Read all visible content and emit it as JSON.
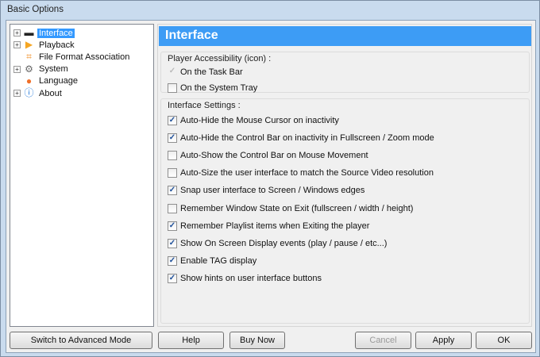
{
  "window": {
    "title": "Basic Options"
  },
  "tree": [
    {
      "label": "Interface",
      "icon": "monitor-icon",
      "expandable": true,
      "selected": true
    },
    {
      "label": "Playback",
      "icon": "play-icon",
      "expandable": true
    },
    {
      "label": "File Format Association",
      "icon": "file-association-icon",
      "expandable": false
    },
    {
      "label": "System",
      "icon": "gear-icon",
      "expandable": true
    },
    {
      "label": "Language",
      "icon": "speech-bubble-icon",
      "expandable": false
    },
    {
      "label": "About",
      "icon": "info-icon",
      "expandable": true
    }
  ],
  "header": "Interface",
  "accessibility": {
    "label": "Player Accessibility (icon) :",
    "options": [
      {
        "label": "On the Task Bar",
        "checked": true,
        "disabled": true
      },
      {
        "label": "On the System Tray",
        "checked": false
      }
    ]
  },
  "settings": {
    "label": "Interface Settings :",
    "options": [
      {
        "label": "Auto-Hide the Mouse Cursor on inactivity",
        "checked": true
      },
      {
        "label": "Auto-Hide the Control Bar on inactivity in Fullscreen / Zoom mode",
        "checked": true
      },
      {
        "label": "Auto-Show the Control Bar on Mouse Movement",
        "checked": false
      },
      {
        "label": "Auto-Size the user interface to match the Source Video resolution",
        "checked": false
      },
      {
        "label": "Snap user interface to Screen / Windows edges",
        "checked": true
      },
      {
        "label": "Remember Window State on Exit (fullscreen / width / height)",
        "checked": false
      },
      {
        "label": "Remember Playlist items when Exiting the player",
        "checked": true
      },
      {
        "label": "Show On Screen Display events (play / pause / etc...)",
        "checked": true
      },
      {
        "label": "Enable TAG display",
        "checked": true
      },
      {
        "label": "Show hints on user interface buttons",
        "checked": true
      }
    ]
  },
  "buttons": {
    "advanced": "Switch to Advanced Mode",
    "help": "Help",
    "buy": "Buy Now",
    "cancel": "Cancel",
    "apply": "Apply",
    "ok": "OK"
  }
}
